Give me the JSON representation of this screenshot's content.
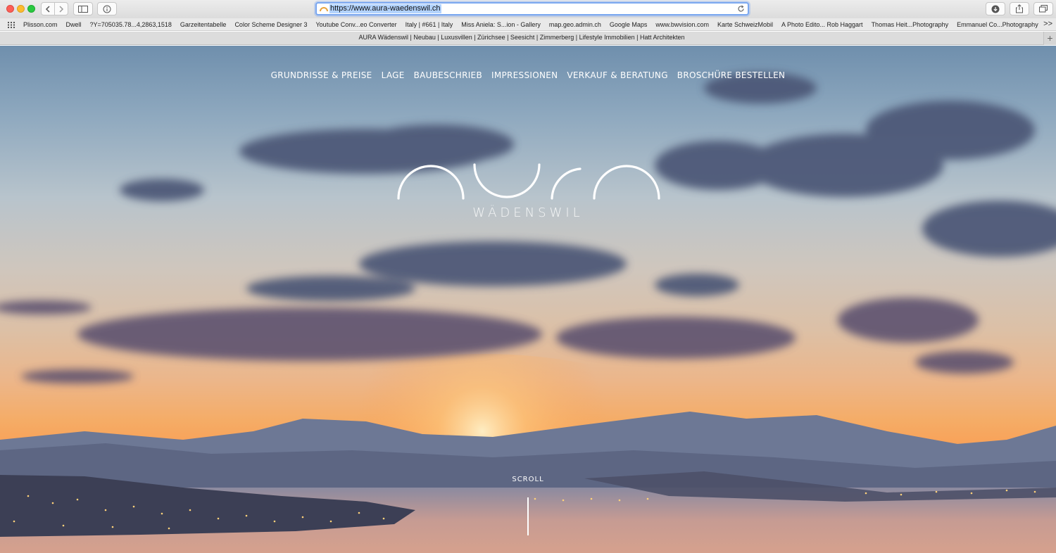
{
  "browser": {
    "url": "https://www.aura-waedenswil.ch",
    "tab_title": "AURA Wädenswil | Neubau | Luxusvillen | Zürichsee | Seesicht | Zimmerberg | Lifestyle Immobilien | Hatt Architekten",
    "tab_add": "+",
    "bookmarks_more": ">>",
    "bookmarks": [
      "Plisson.com",
      "Dwell",
      "?Y=705035.78...4,2863,1518",
      "Garzeitentabelle",
      "Color Scheme Designer 3",
      "Youtube Conv...eo Converter",
      "Italy | #661 | Italy",
      "Miss Aniela: S...ion - Gallery",
      "map.geo.admin.ch",
      "Google Maps",
      "www.bwvision.com",
      "Karte SchweizMobil",
      "A Photo Edito... Rob Haggart",
      "Thomas Heit...Photography",
      "Emmanuel Co...Photography"
    ]
  },
  "site": {
    "nav": [
      "GRUNDRISSE & PREISE",
      "LAGE",
      "BAUBESCHRIEB",
      "IMPRESSIONEN",
      "VERKAUF & BERATUNG",
      "BROSCHÜRE BESTELLEN"
    ],
    "logo_subtitle": "WÄDENSWIL",
    "scroll_label": "SCROLL"
  },
  "colors": {
    "sky_top": "#6f8fad",
    "sunset": "#f8a35a",
    "cloud": "#4a5878",
    "address_focus": "#7aa7f0"
  }
}
